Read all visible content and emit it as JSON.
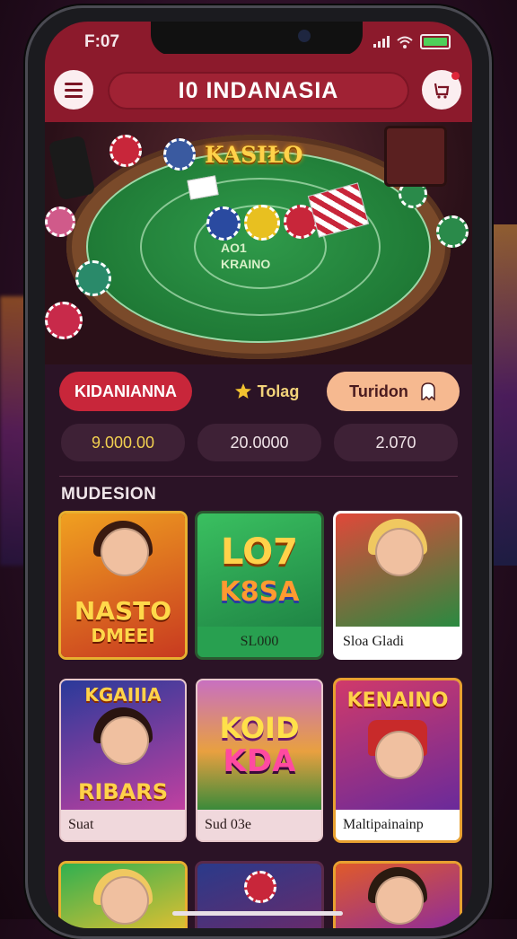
{
  "status_bar": {
    "time": "F:07"
  },
  "header": {
    "title": "I0 INDANASIA",
    "menu_icon": "hamburger-icon",
    "cart_icon": "cart-icon"
  },
  "hero": {
    "logo": "KASIŁO",
    "felt_line1": "AO1",
    "felt_line2": "KRAINO"
  },
  "tabs": [
    {
      "label": "KIDANIANNA"
    },
    {
      "label": "Tolag",
      "icon": "star-icon"
    },
    {
      "label": "Turidon",
      "icon": "ghost-icon"
    }
  ],
  "stats": [
    {
      "value": "9.000.00"
    },
    {
      "value": "20.0000"
    },
    {
      "value": "2.070"
    }
  ],
  "section": {
    "title": "MUDESION"
  },
  "games": [
    {
      "big1": "NASTO",
      "big2": "DMEEI",
      "caption": ""
    },
    {
      "big1": "LO7",
      "big2": "K8SA",
      "caption": "SL000"
    },
    {
      "big1": "",
      "big2": "",
      "caption": "Sloa Gladi"
    },
    {
      "big1": "KGAIIIA",
      "big2": "RIBARS",
      "caption": "Suat"
    },
    {
      "big1": "KOID",
      "big2": "KDA",
      "caption": "Sud 03e"
    },
    {
      "big1": "KENAINO",
      "big2": "",
      "caption": "Maltipainainp"
    }
  ],
  "colors": {
    "accent": "#8c1a2c",
    "tab_red": "#c8263a",
    "tab_peach": "#f6b990",
    "gold": "#f2d050"
  }
}
